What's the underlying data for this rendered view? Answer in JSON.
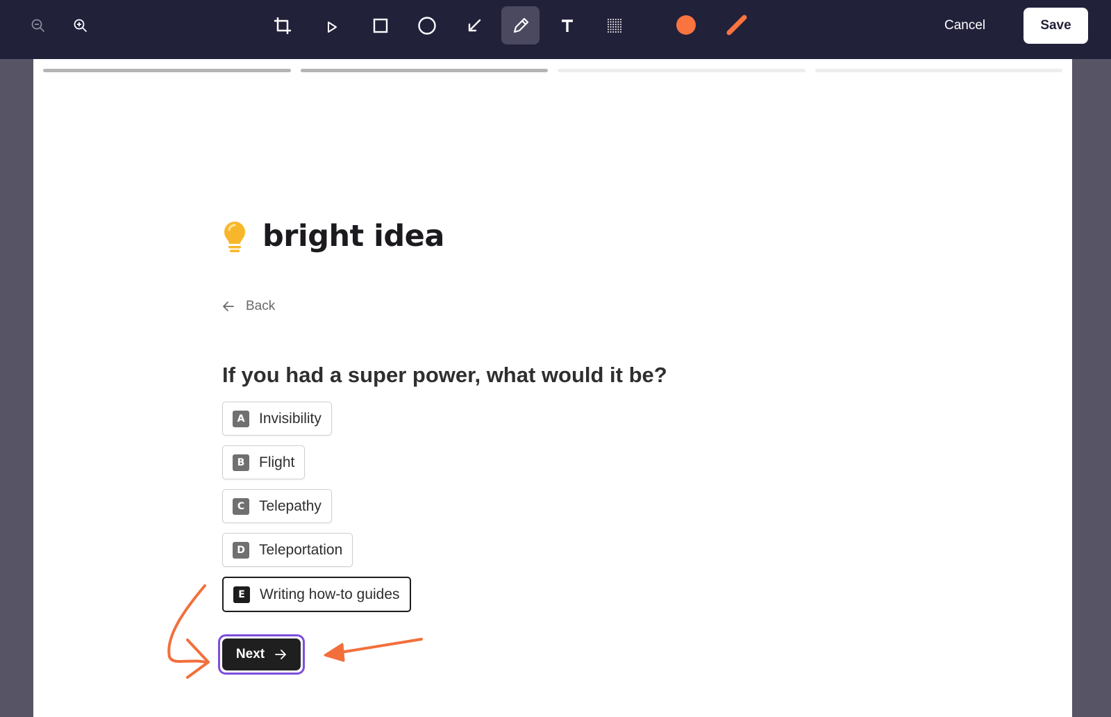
{
  "toolbar": {
    "tools": [
      {
        "name": "zoom-out-icon"
      },
      {
        "name": "zoom-in-icon"
      },
      {
        "name": "crop-icon"
      },
      {
        "name": "select-pointer-icon"
      },
      {
        "name": "rectangle-icon"
      },
      {
        "name": "ellipse-icon"
      },
      {
        "name": "arrow-icon"
      },
      {
        "name": "pen-icon",
        "active": true
      },
      {
        "name": "text-icon"
      },
      {
        "name": "blur-icon"
      }
    ],
    "color": "#f9743f",
    "cancel_label": "Cancel",
    "save_label": "Save"
  },
  "form": {
    "progress": {
      "total_steps": 4,
      "completed_steps": 2
    },
    "logo": {
      "text": "bright idea",
      "icon": "lightbulb-icon",
      "icon_color": "#f8b72b"
    },
    "back_label": "Back",
    "question": "If you had a super power, what would it be?",
    "options": [
      {
        "key": "A",
        "label": "Invisibility"
      },
      {
        "key": "B",
        "label": "Flight"
      },
      {
        "key": "C",
        "label": "Telepathy"
      },
      {
        "key": "D",
        "label": "Teleportation"
      },
      {
        "key": "E",
        "label": "Writing how-to guides",
        "selected": true
      }
    ],
    "next_label": "Next"
  },
  "annotations": {
    "stroke_color": "#f26f3c",
    "highlight_color": "#7c4ddc"
  }
}
